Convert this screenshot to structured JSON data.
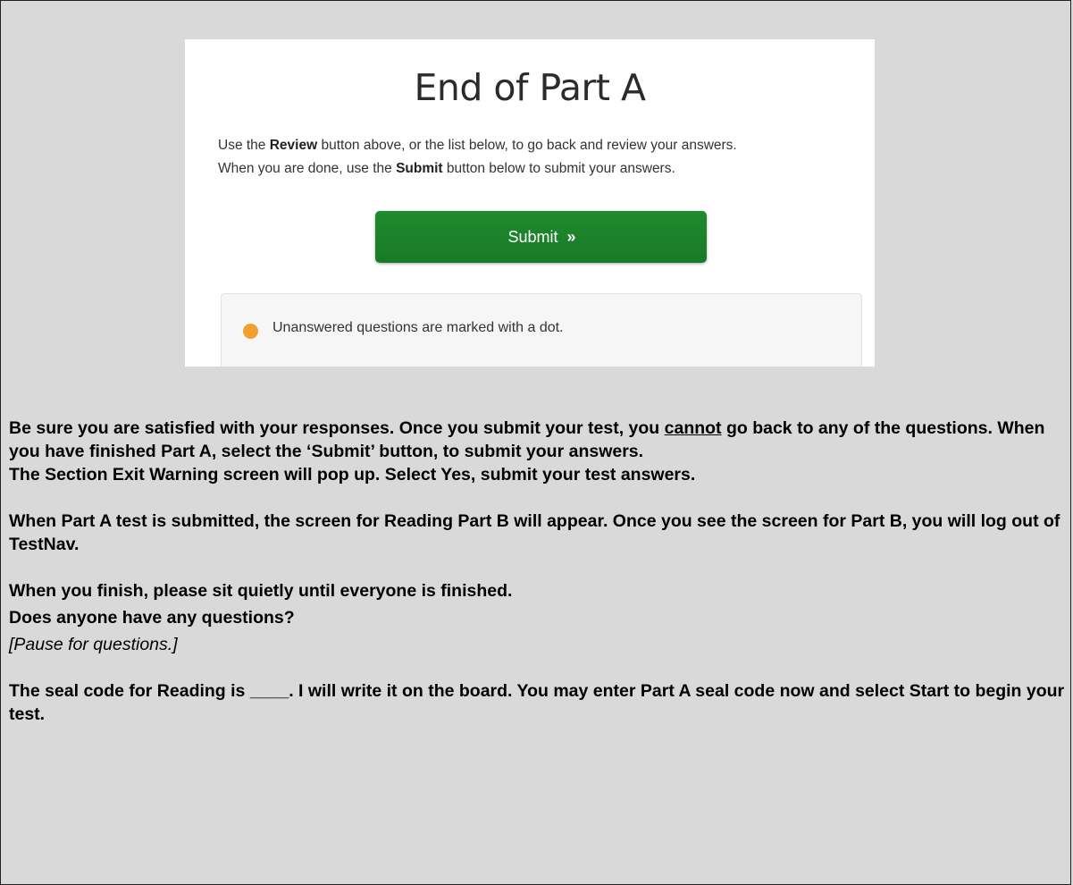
{
  "screenshot": {
    "title": "End of Part A",
    "instruction_line1_pre": "Use the ",
    "instruction_line1_bold": "Review",
    "instruction_line1_post": " button above, or the list below, to go back and review your answers.",
    "instruction_line2_pre": "When you are done, use the ",
    "instruction_line2_bold": "Submit",
    "instruction_line2_post": " button below to submit your answers.",
    "submit_label": "Submit",
    "submit_chevron": "»",
    "legend_text": "Unanswered questions are marked with a dot.",
    "colors": {
      "submit_button": "#1f8a2e",
      "unanswered_dot": "#f0a030"
    }
  },
  "body": {
    "p1_pre": "Be sure you are satisfied with your responses. Once you submit your test, you ",
    "p1_underlined": "cannot",
    "p1_post": " go back to any of the questions. When you have finished Part A, select the ‘Submit’ button, to submit your answers.",
    "p2": "The Section Exit Warning screen will pop up. Select Yes, submit your test answers.",
    "p3": "When Part A test is submitted, the screen for Reading Part B will appear. Once you see the screen for Part B, you will log out of TestNav.",
    "p4": "When you finish, please sit quietly until everyone is finished.",
    "p5": "Does anyone have any questions?",
    "p6": "[Pause for questions.]",
    "p7": "The seal code for Reading is ____. I will write it on the board. You may enter Part A seal code now and select Start to begin your test."
  }
}
